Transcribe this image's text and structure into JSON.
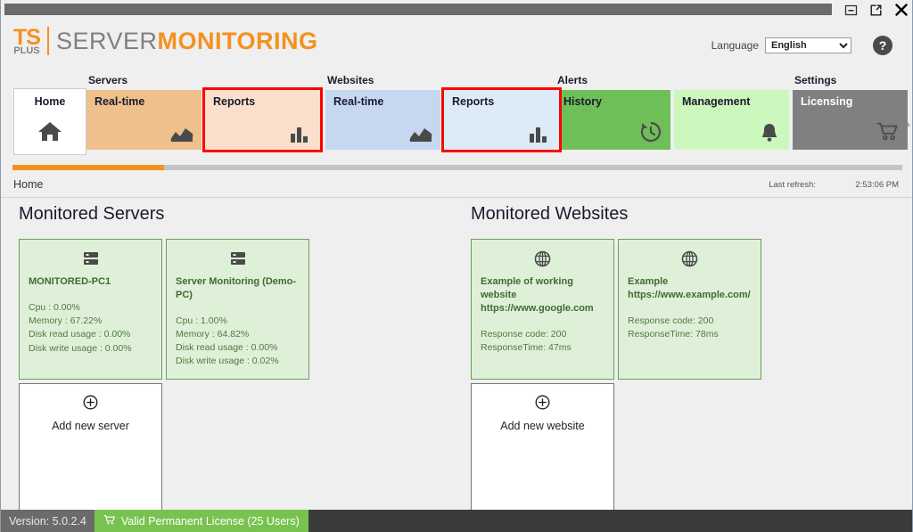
{
  "titlebar": {
    "minimize_icon": "minimize-icon",
    "restore_icon": "restore-window-icon",
    "close_icon": "close-icon"
  },
  "brand": {
    "ts": "TS",
    "plus": "PLUS",
    "word1": "SERVER",
    "word2": "MONITORING",
    "orange": "#f5911e",
    "gray": "#808080"
  },
  "header": {
    "language_label": "Language",
    "language_value": "English",
    "language_options": [
      "English"
    ],
    "help_label": "?"
  },
  "nav": {
    "groups": [
      {
        "label": "Servers",
        "tiles": [
          {
            "label": "Real-time",
            "icon": "area-chart-icon",
            "style": "orange",
            "selected": false
          },
          {
            "label": "Reports",
            "icon": "bar-chart-icon",
            "style": "orange-l",
            "selected": true
          }
        ]
      },
      {
        "label": "Websites",
        "tiles": [
          {
            "label": "Real-time",
            "icon": "area-chart-icon",
            "style": "blue",
            "selected": false
          },
          {
            "label": "Reports",
            "icon": "bar-chart-icon",
            "style": "blue-l",
            "selected": true
          }
        ]
      },
      {
        "label": "Alerts",
        "tiles": [
          {
            "label": "History",
            "icon": "clock-history-icon",
            "style": "green",
            "selected": false
          },
          {
            "label": "Management",
            "icon": "bell-icon",
            "style": "green-l",
            "selected": false
          }
        ]
      },
      {
        "label": "Settings",
        "tiles": [
          {
            "label": "Licensing",
            "icon": "shopping-cart-icon",
            "style": "gray",
            "selected": false
          }
        ]
      }
    ],
    "home_tile": {
      "label": "Home",
      "icon": "home-icon"
    },
    "chevron": "›"
  },
  "breadcrumb": {
    "current": "Home",
    "refresh_label": "Last refresh:",
    "refresh_time": "2:53:06 PM",
    "progress_percent": 17,
    "progress_color": "#f5911e"
  },
  "main": {
    "servers_panel": {
      "title": "Monitored Servers",
      "cards": [
        {
          "icon": "server-icon",
          "name": "MONITORED-PC1",
          "stats": [
            "Cpu : 0.00%",
            "Memory : 67.22%",
            "Disk read usage : 0.00%",
            "Disk write usage : 0.00%"
          ]
        },
        {
          "icon": "server-icon",
          "name": "Server Monitoring (Demo-PC)",
          "stats": [
            "Cpu : 1.00%",
            "Memory : 64.82%",
            "Disk read usage : 0.00%",
            "Disk write usage : 0.02%"
          ]
        }
      ],
      "add_label": "Add new server",
      "add_icon": "plus-circle-icon"
    },
    "websites_panel": {
      "title": "Monitored Websites",
      "cards": [
        {
          "icon": "globe-icon",
          "name": "Example of working website https://www.google.com",
          "stats": [
            "Response code: 200",
            "ResponseTime: 47ms"
          ]
        },
        {
          "icon": "globe-icon",
          "name": "Example https://www.example.com/",
          "stats": [
            "Response code: 200",
            "ResponseTime: 78ms"
          ]
        }
      ],
      "add_label": "Add new website",
      "add_icon": "plus-circle-icon"
    }
  },
  "statusbar": {
    "version": "Version: 5.0.2.4",
    "license": "Valid Permanent License (25 Users)",
    "license_icon": "cart-icon",
    "license_color": "#78c350"
  }
}
